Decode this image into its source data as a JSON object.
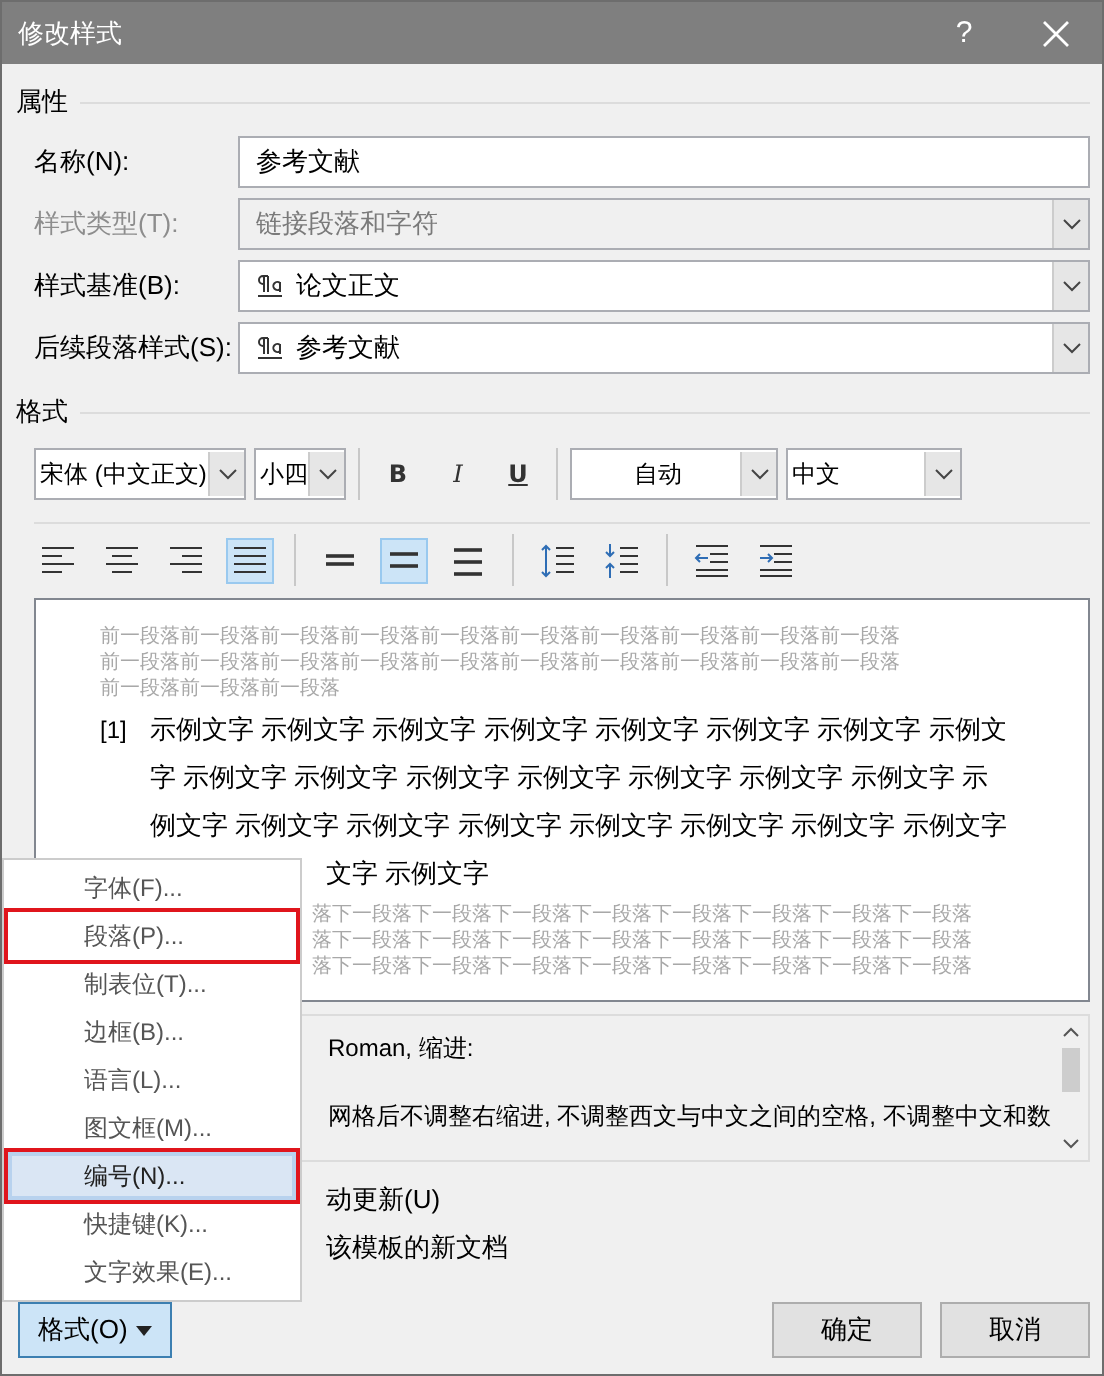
{
  "window": {
    "title": "修改样式",
    "help": "?"
  },
  "properties": {
    "header": "属性",
    "fields": [
      {
        "label": "名称(N):",
        "value": "参考文献",
        "kind": "text",
        "disabled": false
      },
      {
        "label": "样式类型(T):",
        "value": "链接段落和字符",
        "kind": "dropdown",
        "disabled": true
      },
      {
        "label": "样式基准(B):",
        "value": "论文正文",
        "kind": "style-dropdown",
        "disabled": false
      },
      {
        "label": "后续段落样式(S):",
        "value": "参考文献",
        "kind": "style-dropdown",
        "disabled": false
      }
    ]
  },
  "format": {
    "header": "格式",
    "font": "宋体 (中文正文)",
    "size": "小四",
    "bold": "B",
    "italic": "I",
    "underline": "U",
    "font_color": "自动",
    "language": "中文",
    "paragraph_buttons": [
      {
        "kind": "align-left",
        "selected": false
      },
      {
        "kind": "align-center",
        "selected": false
      },
      {
        "kind": "align-right",
        "selected": false
      },
      {
        "kind": "justify",
        "selected": true
      },
      {
        "kind": "single-spacing",
        "selected": false
      },
      {
        "kind": "one-half-spacing",
        "selected": true
      },
      {
        "kind": "double-spacing",
        "selected": false
      },
      {
        "kind": "increase-spacing",
        "selected": false
      },
      {
        "kind": "decrease-spacing",
        "selected": false
      },
      {
        "kind": "decrease-indent",
        "selected": false
      },
      {
        "kind": "increase-indent",
        "selected": false
      }
    ]
  },
  "preview": {
    "before_lines": [
      "前一段落前一段落前一段落前一段落前一段落前一段落前一段落前一段落前一段落前一段落",
      "前一段落前一段落前一段落前一段落前一段落前一段落前一段落前一段落前一段落前一段落",
      "前一段落前一段落前一段落"
    ],
    "number": "[1]",
    "lines": [
      "示例文字 示例文字 示例文字 示例文字 示例文字 示例文字 示例文字 示例文",
      "字 示例文字 示例文字 示例文字 示例文字 示例文字 示例文字 示例文字 示",
      "例文字 示例文字 示例文字 示例文字 示例文字 示例文字 示例文字 示例文字",
      "文字 示例文字"
    ],
    "after_lines": [
      "落下一段落下一段落下一段落下一段落下一段落下一段落下一段落下一段落",
      "落下一段落下一段落下一段落下一段落下一段落下一段落下一段落下一段落",
      "落下一段落下一段落下一段落下一段落下一段落下一段落下一段落下一段落"
    ]
  },
  "description": [
    "Roman, 缩进:",
    "网格后不调整右缩进, 不调整西文与中文之间的空格, 不调整中文和数"
  ],
  "options": [
    "动更新(U)",
    "该模板的新文档"
  ],
  "menu": {
    "items": [
      {
        "label": "字体(F)...",
        "selected": false,
        "annotated": false
      },
      {
        "label": "段落(P)...",
        "selected": false,
        "annotated": true
      },
      {
        "label": "制表位(T)...",
        "selected": false,
        "annotated": false
      },
      {
        "label": "边框(B)...",
        "selected": false,
        "annotated": false
      },
      {
        "label": "语言(L)...",
        "selected": false,
        "annotated": false
      },
      {
        "label": "图文框(M)...",
        "selected": false,
        "annotated": false
      },
      {
        "label": "编号(N)...",
        "selected": true,
        "annotated": true
      },
      {
        "label": "快捷键(K)...",
        "selected": false,
        "annotated": false
      },
      {
        "label": "文字效果(E)...",
        "selected": false,
        "annotated": false
      }
    ]
  },
  "buttons": {
    "format": "格式(O)",
    "ok": "确定",
    "cancel": "取消"
  }
}
